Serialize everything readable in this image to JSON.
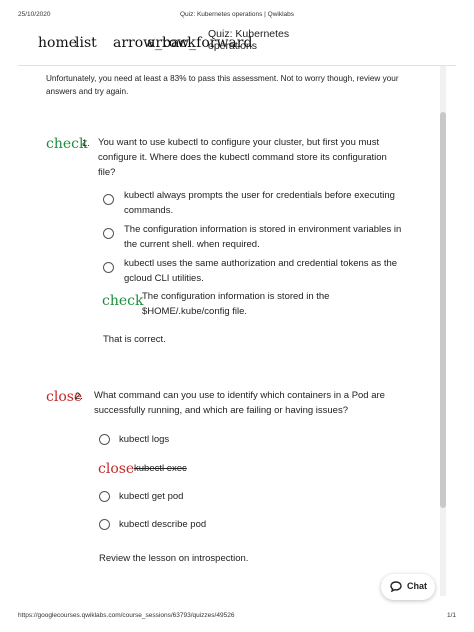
{
  "print_header": {
    "date": "25/10/2020",
    "title": "Quiz: Kubernetes operations | Qwiklabs"
  },
  "topbar": {
    "home_icon_text": "home",
    "list_icon_text": "list",
    "arrow_back_icon_text": "arrow_back",
    "arrow_forward_icon_text": "arrow_forward",
    "quiz_title": "Quiz: Kubernetes operations"
  },
  "notice": "Unfortunately, you need at least a 83% to pass this assessment. Not to worry though, review your answers and try again.",
  "questions": [
    {
      "status_icon": "check",
      "number": "1.",
      "text": "You want to use kubectl to configure your cluster, but first you must configure it. Where does the kubectl command store its configuration file?",
      "options": [
        "kubectl always prompts the user for credentials before executing commands.",
        "The configuration information is stored in environment variables in the current shell. when required.",
        "kubectl uses the same authorization and credential tokens as the gcloud CLI utilities.",
        "The configuration information is stored in the $HOME/.kube/config file."
      ],
      "selected_icon": "check",
      "feedback": "That is correct."
    },
    {
      "status_icon": "close",
      "number": "2.",
      "text": "What command can you use to identify which containers in a Pod are successfully running, and which are failing or having issues?",
      "options": [
        "kubectl logs",
        "kubectl exec",
        "kubectl get pod",
        "kubectl describe pod"
      ],
      "selected_icon": "close",
      "feedback": "Review the lesson on introspection."
    }
  ],
  "chat": {
    "label": "Chat"
  },
  "print_footer": {
    "url": "https://googlecourses.qwiklabs.com/course_sessions/63793/quizzes/49526",
    "page": "1/1"
  },
  "colors": {
    "correct": "#1e8e3e",
    "incorrect": "#c62828",
    "text": "#222222"
  }
}
